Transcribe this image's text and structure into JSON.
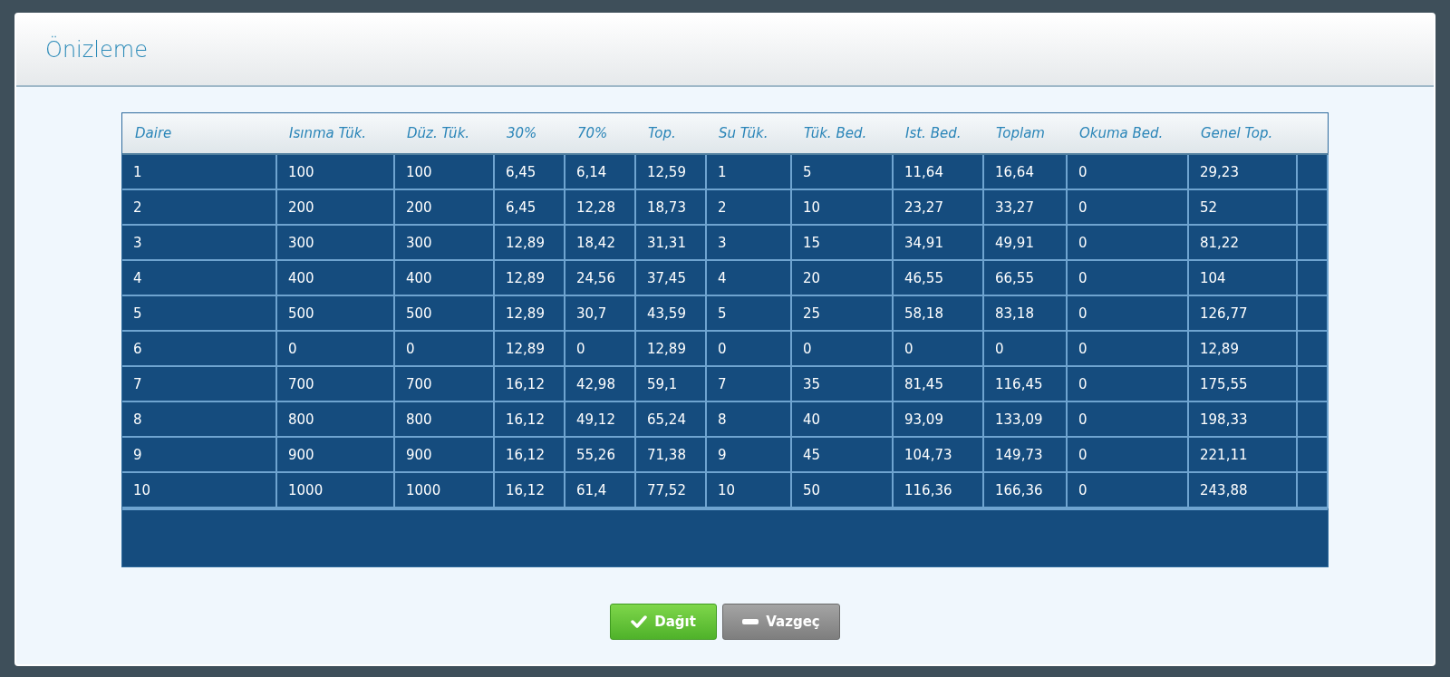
{
  "dialog": {
    "title": "Önizleme"
  },
  "table": {
    "columns": [
      "Daire",
      "Isınma Tük.",
      "Düz. Tük.",
      "30%",
      "70%",
      "Top.",
      "Su Tük.",
      "Tük. Bed.",
      "Ist. Bed.",
      "Toplam",
      "Okuma Bed.",
      "Genel Top."
    ],
    "rows": [
      [
        "1",
        "100",
        "100",
        "6,45",
        "6,14",
        "12,59",
        "1",
        "5",
        "11,64",
        "16,64",
        "0",
        "29,23"
      ],
      [
        "2",
        "200",
        "200",
        "6,45",
        "12,28",
        "18,73",
        "2",
        "10",
        "23,27",
        "33,27",
        "0",
        "52"
      ],
      [
        "3",
        "300",
        "300",
        "12,89",
        "18,42",
        "31,31",
        "3",
        "15",
        "34,91",
        "49,91",
        "0",
        "81,22"
      ],
      [
        "4",
        "400",
        "400",
        "12,89",
        "24,56",
        "37,45",
        "4",
        "20",
        "46,55",
        "66,55",
        "0",
        "104"
      ],
      [
        "5",
        "500",
        "500",
        "12,89",
        "30,7",
        "43,59",
        "5",
        "25",
        "58,18",
        "83,18",
        "0",
        "126,77"
      ],
      [
        "6",
        "0",
        "0",
        "12,89",
        "0",
        "12,89",
        "0",
        "0",
        "0",
        "0",
        "0",
        "12,89"
      ],
      [
        "7",
        "700",
        "700",
        "16,12",
        "42,98",
        "59,1",
        "7",
        "35",
        "81,45",
        "116,45",
        "0",
        "175,55"
      ],
      [
        "8",
        "800",
        "800",
        "16,12",
        "49,12",
        "65,24",
        "8",
        "40",
        "93,09",
        "133,09",
        "0",
        "198,33"
      ],
      [
        "9",
        "900",
        "900",
        "16,12",
        "55,26",
        "71,38",
        "9",
        "45",
        "104,73",
        "149,73",
        "0",
        "221,11"
      ],
      [
        "10",
        "1000",
        "1000",
        "16,12",
        "61,4",
        "77,52",
        "10",
        "50",
        "116,36",
        "166,36",
        "0",
        "243,88"
      ]
    ]
  },
  "buttons": [
    {
      "label": "Dağıt",
      "kind": "confirm"
    },
    {
      "label": "Vazgeç",
      "kind": "cancel"
    }
  ]
}
